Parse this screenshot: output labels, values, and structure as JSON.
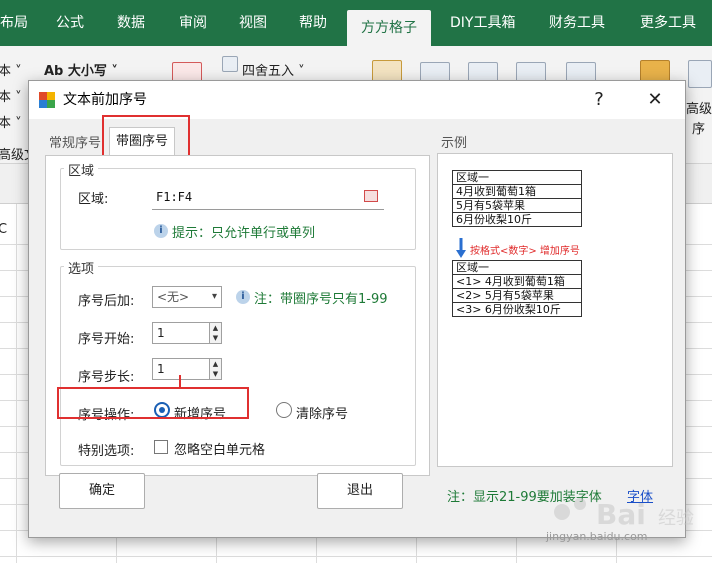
{
  "ribbon_tabs": [
    {
      "label": "布局"
    },
    {
      "label": "公式"
    },
    {
      "label": "数据"
    },
    {
      "label": "审阅"
    },
    {
      "label": "视图"
    },
    {
      "label": "帮助"
    },
    {
      "label": "方方格子"
    },
    {
      "label": "DIY工具箱"
    },
    {
      "label": "财务工具"
    },
    {
      "label": "更多工具"
    }
  ],
  "ribbon": {
    "left_items": [
      "本 ˅",
      "本 ˅",
      "本 ˅",
      "高级文"
    ],
    "case_label": "Ab 大小写 ˅",
    "round_label": "四舍五入 ˅",
    "right_labels": [
      "高级",
      "序"
    ],
    "cell_ref": "C"
  },
  "dialog": {
    "title": "文本前加序号",
    "help": "?",
    "close": "✕",
    "tabs": {
      "normal": "常规序号",
      "circled": "带圈序号"
    },
    "area_group": "区域",
    "area_label": "区域:",
    "area_value": "F1:F4",
    "area_hint": "提示：只允许单行或单列",
    "options_group": "选项",
    "suffix_label": "序号后加:",
    "suffix_value": "<无>",
    "suffix_hint": "注：带圈序号只有1-99",
    "start_label": "序号开始:",
    "start_value": "1",
    "step_label": "序号步长:",
    "step_value": "1",
    "op_label": "序号操作:",
    "op_add": "新增序号",
    "op_clear": "清除序号",
    "special_label": "特别选项:",
    "special_check": "忽略空白单元格",
    "ok": "确定",
    "exit": "退出",
    "example_title": "示例",
    "example_before": [
      "区域一",
      "4月收到葡萄1箱",
      "5月有5袋苹果",
      "6月份收梨10斤"
    ],
    "example_note": "按格式<数字> 增加序号",
    "example_after": [
      "区域一",
      "<1> 4月收到葡萄1箱",
      "<2> 5月有5袋苹果",
      "<3> 6月份收梨10斤"
    ],
    "footer_note": "注：显示21-99要加装字体",
    "footer_link": "字体"
  },
  "watermark": {
    "text": "jingyan.baidu.com"
  }
}
